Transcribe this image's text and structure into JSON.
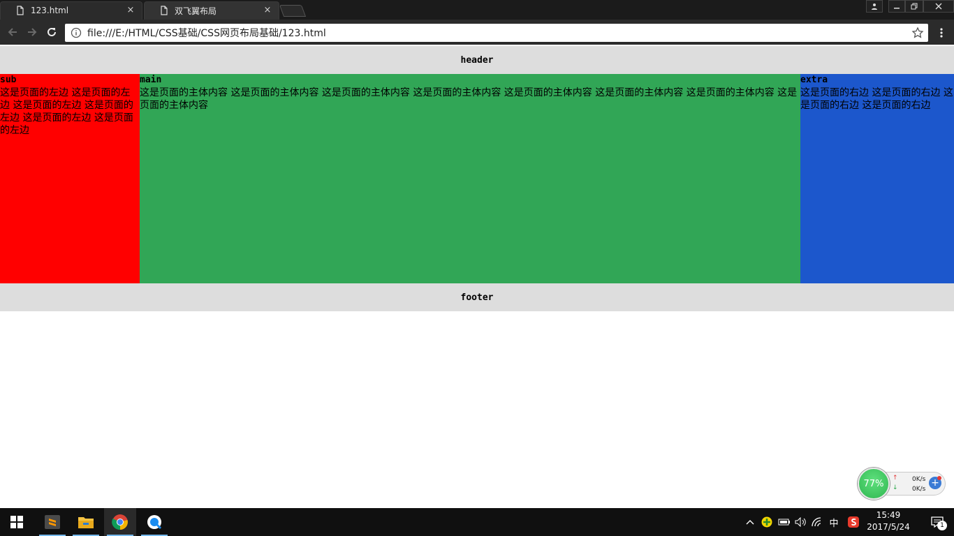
{
  "browser": {
    "tabs": [
      {
        "label": "123.html",
        "active": false
      },
      {
        "label": "双飞翼布局",
        "active": true
      }
    ],
    "address_url": "file:///E:/HTML/CSS基础/CSS网页布局基础/123.html",
    "close_glyph": "×"
  },
  "page": {
    "header": "header",
    "footer": "footer",
    "sub": {
      "title": "sub",
      "text": "这是页面的左边 这是页面的左边 这是页面的左边 这是页面的左边 这是页面的左边 这是页面的左边"
    },
    "main": {
      "title": "main",
      "text": "这是页面的主体内容 这是页面的主体内容 这是页面的主体内容 这是页面的主体内容 这是页面的主体内容 这是页面的主体内容 这是页面的主体内容 这是页面的主体内容"
    },
    "extra": {
      "title": "extra",
      "text": "这是页面的右边 这是页面的右边 这是页面的右边 这是页面的右边"
    },
    "colors": {
      "header_bg": "#dddddd",
      "sub_bg": "#ff0000",
      "main_bg": "#31a656",
      "extra_bg": "#1c57cc"
    }
  },
  "net_monitor": {
    "percent": "77%",
    "upload": "0K/s",
    "download": "0K/s"
  },
  "taskbar": {
    "apps": [
      "sublime-text",
      "file-explorer",
      "chrome",
      "qq-browser"
    ],
    "tray_ime": "中",
    "time": "15:49",
    "date": "2017/5/24",
    "notification_count": "1"
  }
}
